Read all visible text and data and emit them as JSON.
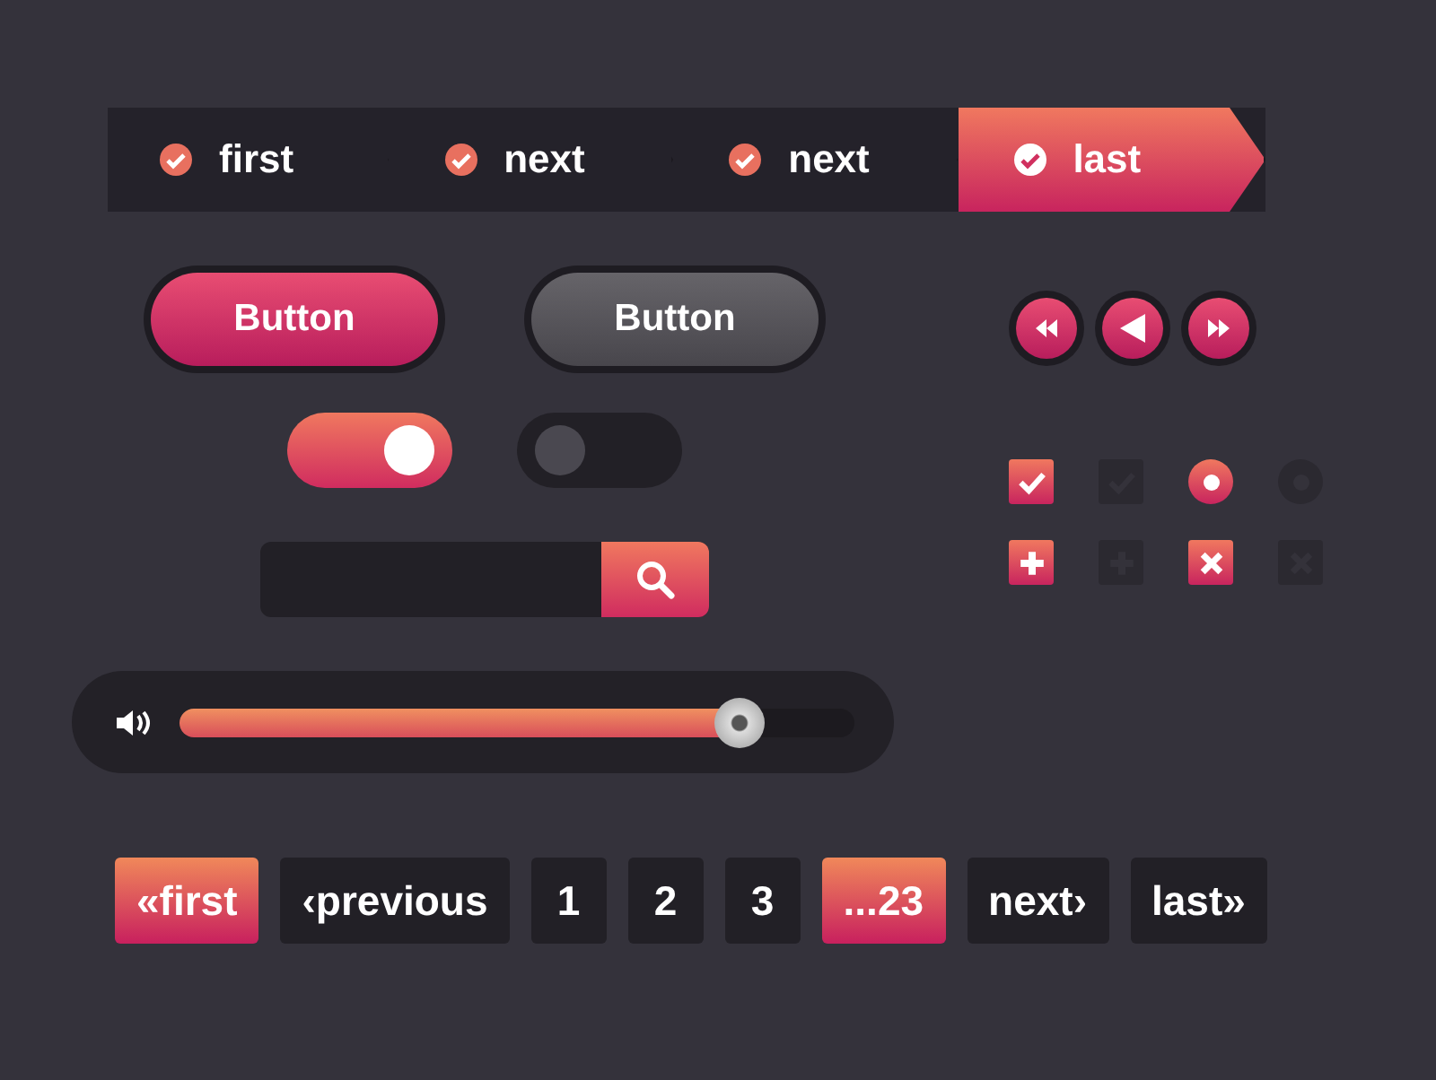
{
  "steps": [
    {
      "label": "first",
      "selected": false
    },
    {
      "label": "next",
      "selected": false
    },
    {
      "label": "next",
      "selected": false
    },
    {
      "label": "last",
      "selected": true
    }
  ],
  "buttons": [
    {
      "label": "Button",
      "kind": "primary"
    },
    {
      "label": "Button",
      "kind": "secondary"
    }
  ],
  "media": [
    {
      "kind": "rewind"
    },
    {
      "kind": "back"
    },
    {
      "kind": "forward"
    }
  ],
  "toggles": [
    {
      "on": true
    },
    {
      "on": false
    }
  ],
  "choices": [
    {
      "kind": "check",
      "checked": true
    },
    {
      "kind": "check",
      "checked": false
    },
    {
      "kind": "radio",
      "checked": true
    },
    {
      "kind": "radio",
      "checked": false
    },
    {
      "kind": "plus",
      "checked": true
    },
    {
      "kind": "plus",
      "checked": false
    },
    {
      "kind": "cross",
      "checked": true
    },
    {
      "kind": "cross",
      "checked": false
    }
  ],
  "volume": {
    "level": 0.83
  },
  "pagination": [
    {
      "label": "«first",
      "selected": true
    },
    {
      "label": "‹previous",
      "selected": false
    },
    {
      "label": "1",
      "selected": false
    },
    {
      "label": "2",
      "selected": false
    },
    {
      "label": "3",
      "selected": false
    },
    {
      "label": "...23",
      "selected": true
    },
    {
      "label": "next›",
      "selected": false
    },
    {
      "label": "last»",
      "selected": false
    }
  ]
}
